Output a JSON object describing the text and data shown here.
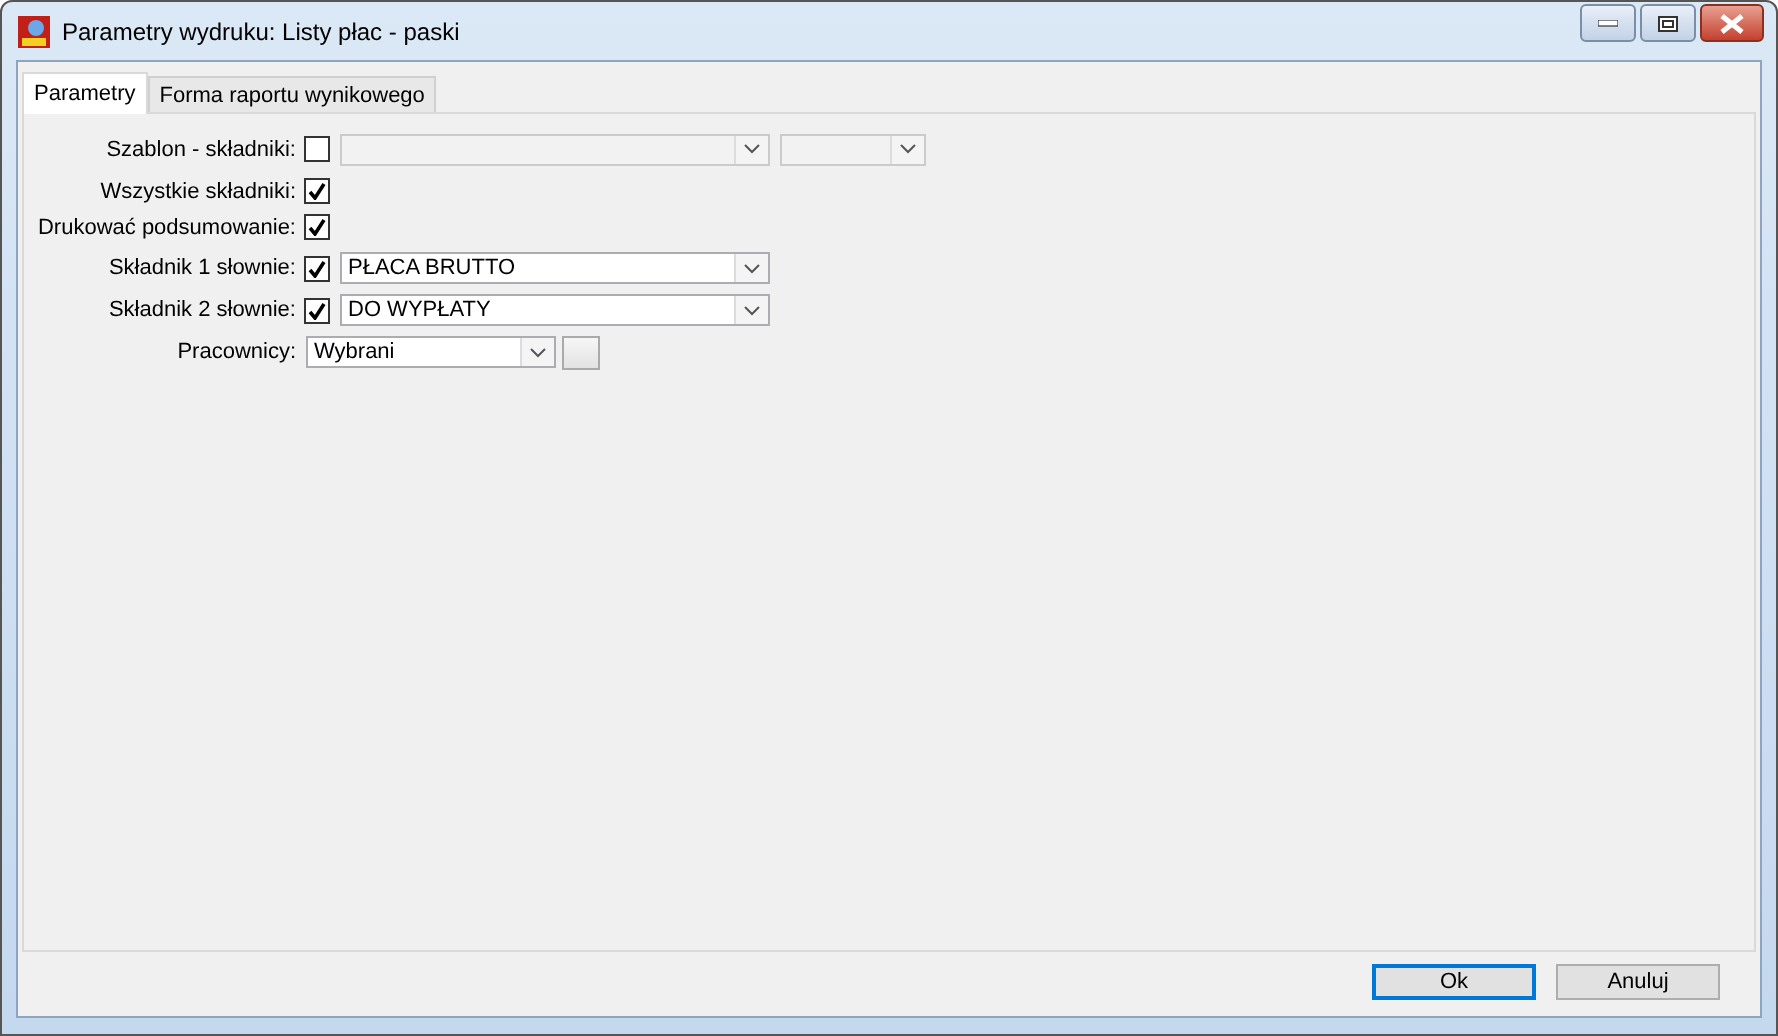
{
  "window": {
    "title": "Parametry wydruku: Listy płac - paski"
  },
  "tabs": [
    {
      "label": "Parametry",
      "selected": true
    },
    {
      "label": "Forma raportu wynikowego",
      "selected": false
    }
  ],
  "rows": [
    {
      "label": "Szablon - składniki:",
      "checked": false,
      "combos": [
        {
          "disabled": true
        },
        {
          "disabled": true
        }
      ]
    },
    {
      "label": "Wszystkie składniki:",
      "checked": true
    },
    {
      "label": "Drukować podsumowanie:",
      "checked": true
    },
    {
      "label": "Składnik 1 słownie:",
      "checked": true,
      "combos": [
        {
          "value": "PŁACA BRUTTO",
          "disabled": false
        }
      ]
    },
    {
      "label": "Składnik 2 słownie:",
      "checked": true,
      "combos": [
        {
          "value": "DO WYPŁATY",
          "disabled": false
        }
      ]
    },
    {
      "label": "Pracownicy:",
      "combos": [
        {
          "value": "Wybrani",
          "disabled": false
        }
      ],
      "button": true
    }
  ],
  "buttons": [
    {
      "label": "Ok",
      "default": true
    },
    {
      "label": "Anuluj",
      "default": false
    }
  ]
}
